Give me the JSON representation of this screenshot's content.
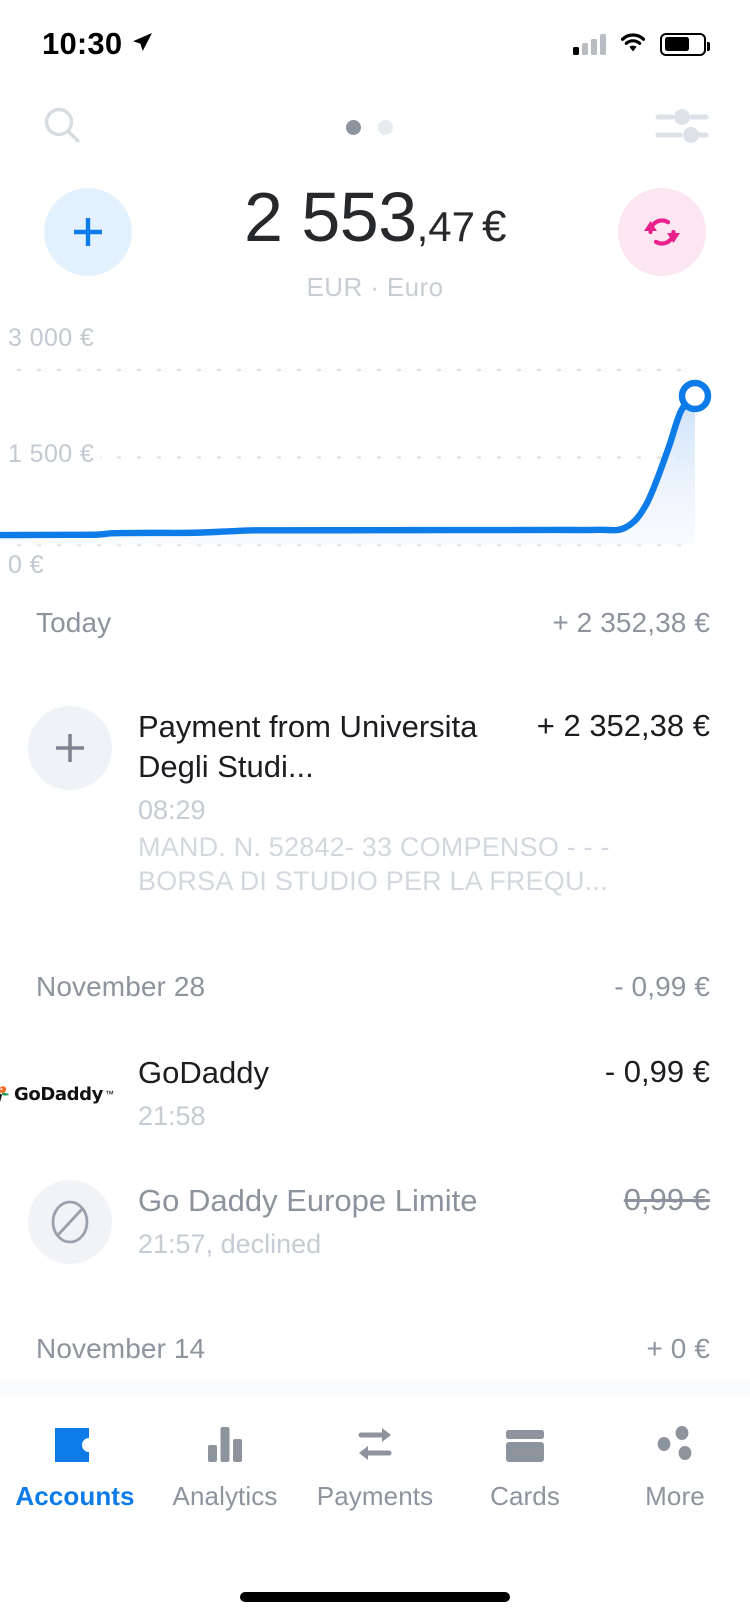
{
  "status_bar": {
    "time": "10:30",
    "location_icon": "location-arrow-icon",
    "signal_icon": "cellular-signal-icon",
    "wifi_icon": "wifi-icon",
    "battery_icon": "battery-icon"
  },
  "toolbar": {
    "search_icon": "search-icon",
    "filter_icon": "filter-sliders-icon",
    "page_dots": {
      "count": 2,
      "active_index": 0
    }
  },
  "account_header": {
    "add_button_label": "+",
    "add_icon": "plus-icon",
    "exchange_icon": "exchange-refresh-icon",
    "balance_integer": "2 553",
    "balance_decimal": ",47",
    "currency_symbol": "€",
    "currency_line": "EUR · Euro",
    "accent_blue": "#0d7ce8",
    "accent_pink": "#e9218c",
    "add_bg": "#e3f0fd",
    "exchange_bg": "#fce6f1"
  },
  "chart_data": {
    "type": "area",
    "title": "",
    "xlabel": "",
    "ylabel": "",
    "ylim": [
      0,
      3000
    ],
    "ytick_labels": [
      "3 000 €",
      "1 500 €",
      "0 €"
    ],
    "ytick_values": [
      3000,
      1500,
      0
    ],
    "grid": true,
    "legend_position": "none",
    "line_color": "#0d7ce8",
    "fill_color": "#d8e8fa",
    "marker": {
      "type": "hollow-circle",
      "x": 100,
      "y": 2553.47,
      "label": "2 553,47 €"
    },
    "x": [
      0,
      5,
      10,
      14,
      16,
      18,
      22,
      28,
      33,
      36,
      40,
      50,
      60,
      70,
      80,
      86,
      90,
      93,
      96,
      98,
      100
    ],
    "values": [
      170,
      172,
      175,
      178,
      200,
      205,
      208,
      210,
      235,
      250,
      252,
      253,
      255,
      256,
      258,
      260,
      300,
      700,
      1600,
      2300,
      2553
    ]
  },
  "sections": [
    {
      "date": "Today",
      "total": "+ 2 352,38 €",
      "transactions": [
        {
          "icon": "plus-icon",
          "icon_style": "plus",
          "title": "Payment from Universita  Degli Studi...",
          "amount": "+ 2 352,38 €",
          "time": "08:29",
          "description": "MAND. N. 52842- 33 COMPENSO - - - BORSA        DI STUDIO PER LA FREQU...",
          "declined": false
        }
      ]
    },
    {
      "date": "November 28",
      "total": "- 0,99 €",
      "transactions": [
        {
          "icon": "godaddy-logo-icon",
          "icon_style": "logo",
          "logo_text": "GoDaddy",
          "logo_tm": "™",
          "title": "GoDaddy",
          "amount": "- 0,99 €",
          "time": "21:58",
          "description": "",
          "declined": false
        },
        {
          "icon": "blocked-circle-icon",
          "icon_style": "blocked",
          "title": "Go Daddy Europe Limite",
          "amount": "0,99 €",
          "time": "21:57, declined",
          "description": "",
          "declined": true
        }
      ]
    },
    {
      "date": "November 14",
      "total": "+ 0 €",
      "transactions": []
    }
  ],
  "tab_bar": {
    "items": [
      {
        "label": "Accounts",
        "icon": "wallet-icon",
        "active": true
      },
      {
        "label": "Analytics",
        "icon": "bar-chart-icon",
        "active": false
      },
      {
        "label": "Payments",
        "icon": "transfer-arrows-icon",
        "active": false
      },
      {
        "label": "Cards",
        "icon": "credit-card-icon",
        "active": false
      },
      {
        "label": "More",
        "icon": "more-dots-icon",
        "active": false
      }
    ]
  }
}
